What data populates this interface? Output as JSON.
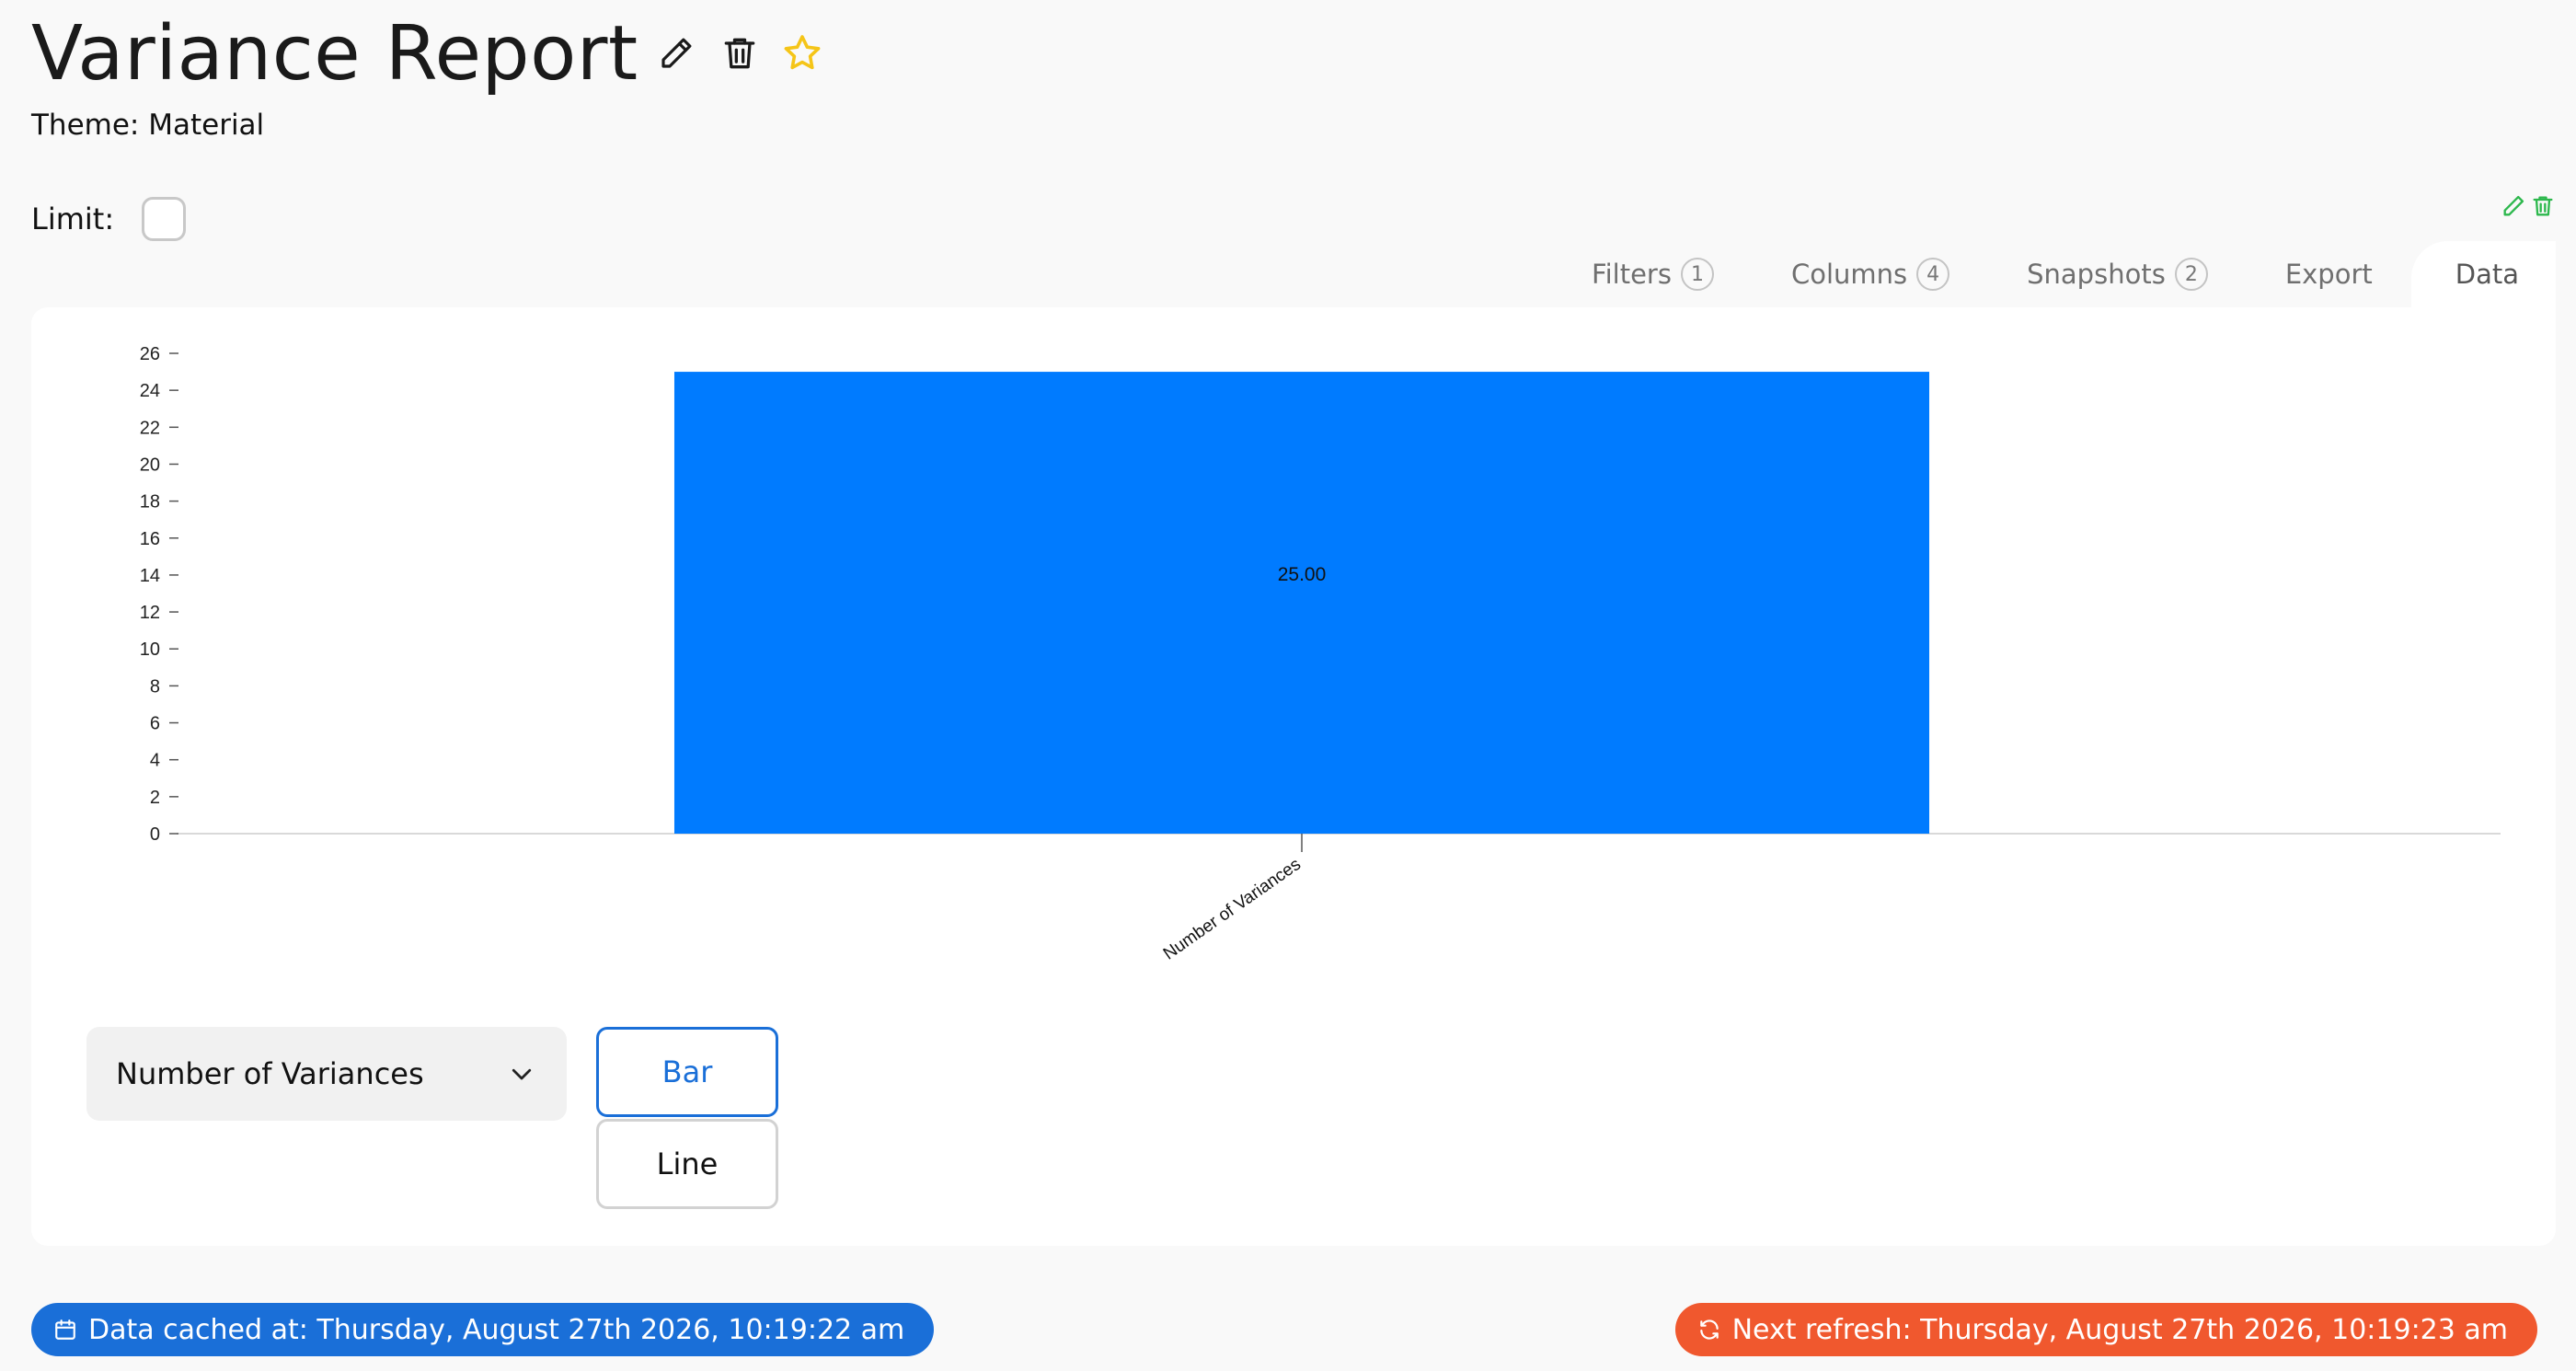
{
  "header": {
    "title": "Variance Report",
    "theme_label": "Theme: Material",
    "accent_color": "#ffcf1a"
  },
  "limit": {
    "label": "Limit:",
    "checked": false
  },
  "tabs": [
    {
      "label": "Filters",
      "count": "1"
    },
    {
      "label": "Columns",
      "count": "4"
    },
    {
      "label": "Snapshots",
      "count": "2"
    },
    {
      "label": "Export",
      "count": ""
    },
    {
      "label": "Data",
      "count": "",
      "active": true
    }
  ],
  "chart_data": {
    "type": "bar",
    "categories": [
      "Number of Variances"
    ],
    "values": [
      25
    ],
    "value_labels": [
      "25.00"
    ],
    "yticks": [
      0,
      2,
      4,
      6,
      8,
      10,
      12,
      14,
      16,
      18,
      20,
      22,
      24,
      26
    ],
    "ylim": [
      0,
      26
    ],
    "bar_color": "#007bff",
    "grid": false,
    "title": "",
    "xlabel": "",
    "ylabel": ""
  },
  "controls": {
    "measure_select": "Number of Variances",
    "chart_types": [
      "Bar",
      "Line"
    ],
    "selected_type": "Bar"
  },
  "footer": {
    "cached": "Data cached at: Thursday, August 27th 2026, 10:19:22 am",
    "refresh": "Next refresh: Thursday, August 27th 2026, 10:19:23 am",
    "cached_color": "#1a6fd8",
    "refresh_color": "#f0582e"
  }
}
